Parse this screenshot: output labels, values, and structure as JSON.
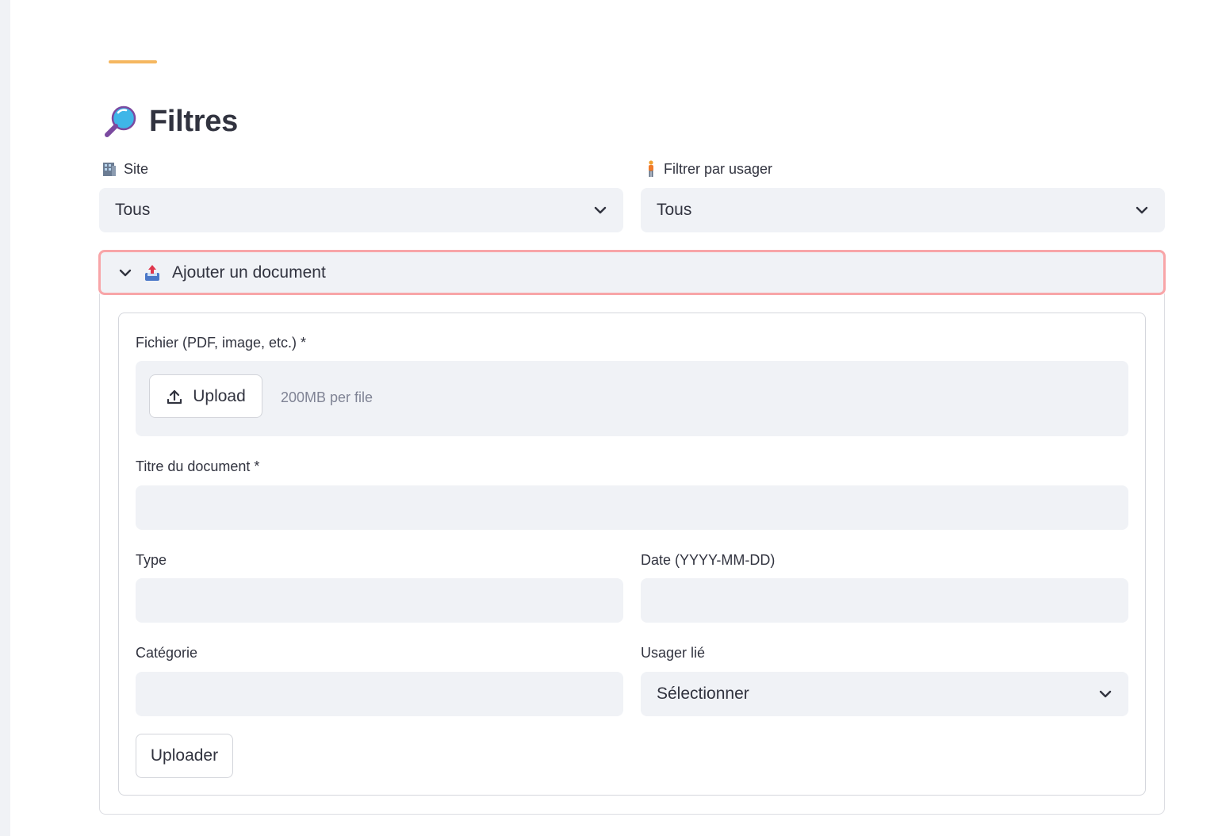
{
  "page": {
    "title": "Filtres",
    "title_icon": "magnifier-icon"
  },
  "filters": {
    "site": {
      "label": "Site",
      "icon": "office-building-icon",
      "value": "Tous"
    },
    "usager": {
      "label": "Filtrer par usager",
      "icon": "person-standing-icon",
      "value": "Tous"
    }
  },
  "expander": {
    "label": "Ajouter un document",
    "icon": "outbox-tray-icon",
    "expanded": true
  },
  "form": {
    "file": {
      "label": "Fichier (PDF, image, etc.) *",
      "upload_label": "Upload",
      "limit_hint": "200MB per file"
    },
    "title": {
      "label": "Titre du document *",
      "value": ""
    },
    "type": {
      "label": "Type",
      "value": ""
    },
    "date": {
      "label": "Date (YYYY-MM-DD)",
      "value": ""
    },
    "category": {
      "label": "Catégorie",
      "value": ""
    },
    "linked_user": {
      "label": "Usager lié",
      "value": "Sélectionner"
    },
    "submit_label": "Uploader"
  },
  "colors": {
    "accent_bar": "#f5b760",
    "focus_border": "#f8a5a8",
    "input_bg": "#f0f2f6",
    "text": "#31333f"
  }
}
